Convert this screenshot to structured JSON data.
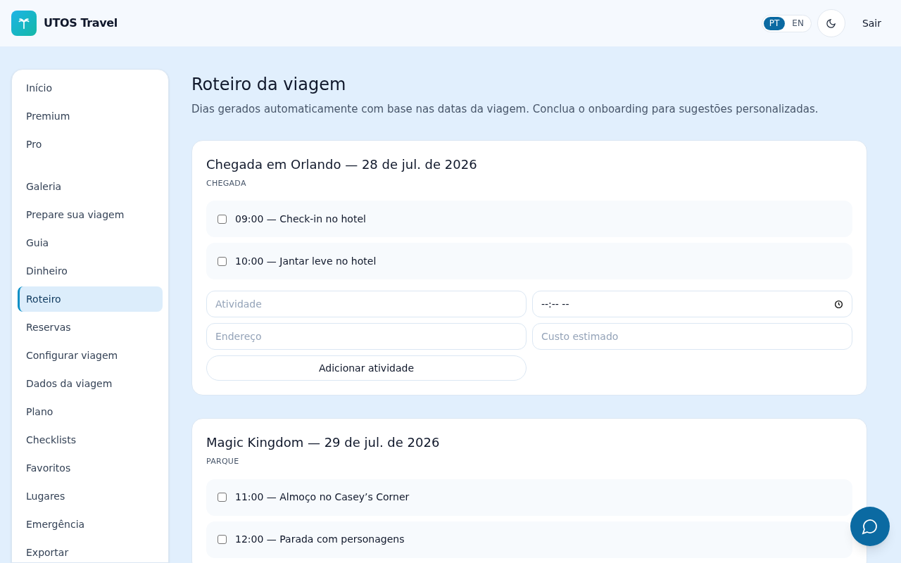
{
  "header": {
    "brand": "UTOS Travel",
    "languages": [
      {
        "label": "PT",
        "selected": true
      },
      {
        "label": "EN",
        "selected": false
      }
    ],
    "logout": "Sair"
  },
  "sidebar": {
    "groups": [
      [
        {
          "label": "Início",
          "selected": false
        },
        {
          "label": "Premium",
          "selected": false
        },
        {
          "label": "Pro",
          "selected": false
        }
      ],
      [
        {
          "label": "Galeria",
          "selected": false
        },
        {
          "label": "Prepare sua viagem",
          "selected": false
        },
        {
          "label": "Guia",
          "selected": false
        },
        {
          "label": "Dinheiro",
          "selected": false
        },
        {
          "label": "Roteiro",
          "selected": true
        },
        {
          "label": "Reservas",
          "selected": false
        },
        {
          "label": "Configurar viagem",
          "selected": false
        },
        {
          "label": "Dados da viagem",
          "selected": false
        },
        {
          "label": "Plano",
          "selected": false
        },
        {
          "label": "Checklists",
          "selected": false
        },
        {
          "label": "Favoritos",
          "selected": false
        },
        {
          "label": "Lugares",
          "selected": false
        },
        {
          "label": "Emergência",
          "selected": false
        },
        {
          "label": "Exportar",
          "selected": false
        }
      ]
    ]
  },
  "page": {
    "title": "Roteiro da viagem",
    "subtitle": "Dias gerados automaticamente com base nas datas da viagem. Conclua o onboarding para sugestões personalizadas."
  },
  "days": [
    {
      "title": "Chegada em Orlando — 28 de jul. de 2026",
      "type": "CHEGADA",
      "activities": [
        {
          "label": "09:00 — Check-in no hotel",
          "checked": false
        },
        {
          "label": "10:00 — Jantar leve no hotel",
          "checked": false
        }
      ],
      "form": {
        "activity_placeholder": "Atividade",
        "time_value": "--:-- --",
        "address_placeholder": "Endereço",
        "cost_placeholder": "Custo estimado",
        "button": "Adicionar atividade"
      }
    },
    {
      "title": "Magic Kingdom — 29 de jul. de 2026",
      "type": "PARQUE",
      "activities": [
        {
          "label": "11:00 — Almoço no Casey’s Corner",
          "checked": false
        },
        {
          "label": "12:00 — Parada com personagens",
          "checked": false
        }
      ]
    }
  ]
}
